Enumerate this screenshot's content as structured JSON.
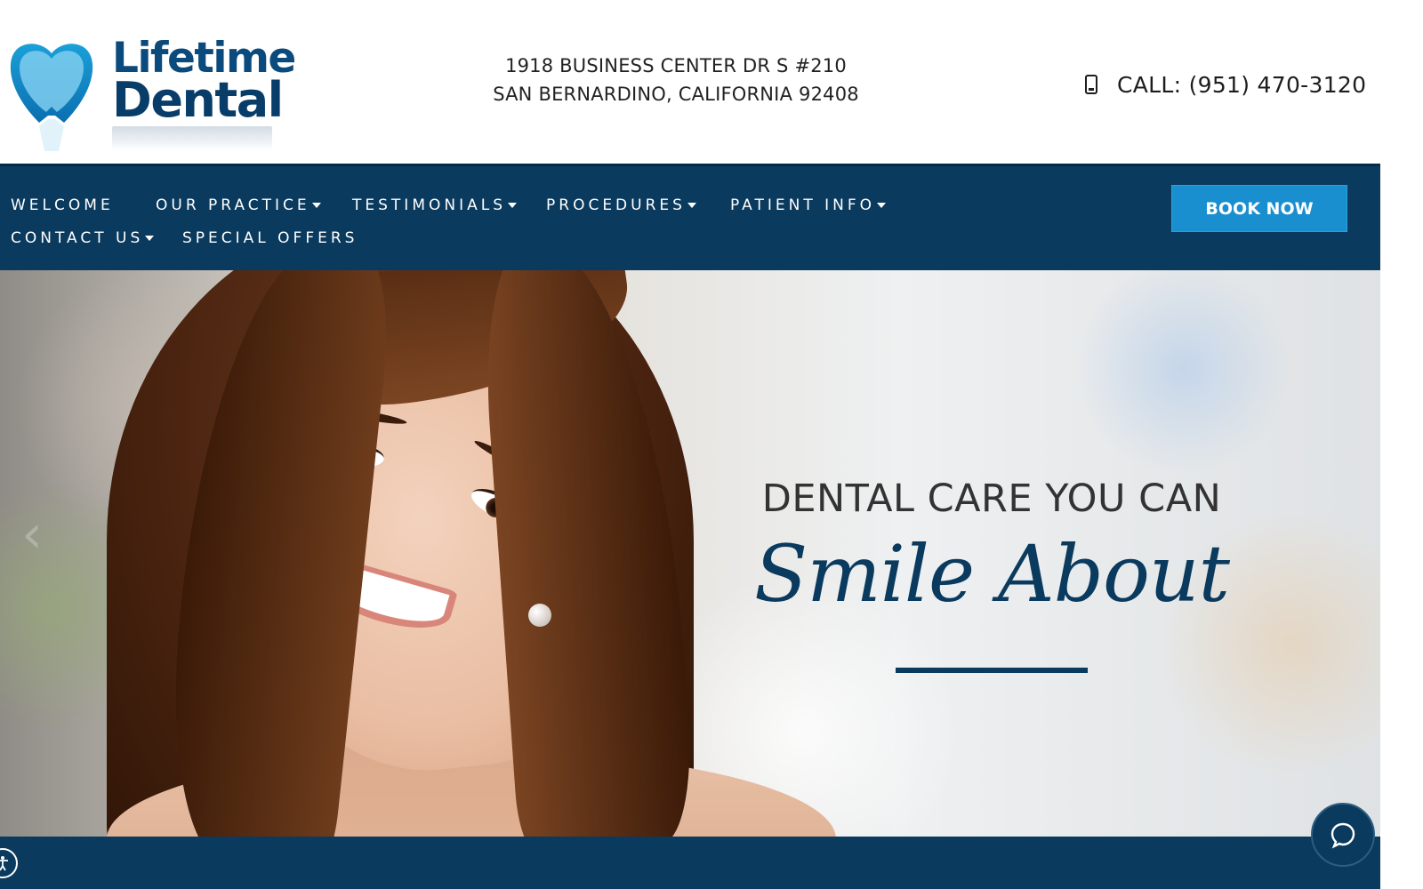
{
  "header": {
    "logo": {
      "line1": "Lifetime",
      "line2": "Dental"
    },
    "address": {
      "line1": "1918 BUSINESS CENTER DR S #210",
      "line2": "SAN BERNARDINO, CALIFORNIA 92408"
    },
    "phone": {
      "label": "CALL: (951) 470-3120",
      "icon": "mobile-phone-icon"
    }
  },
  "nav": {
    "items": [
      {
        "label": "WELCOME",
        "has_dropdown": false
      },
      {
        "label": "OUR PRACTICE",
        "has_dropdown": true
      },
      {
        "label": "TESTIMONIALS",
        "has_dropdown": true
      },
      {
        "label": "PROCEDURES",
        "has_dropdown": true
      },
      {
        "label": "PATIENT INFO",
        "has_dropdown": true
      },
      {
        "label": "CONTACT US",
        "has_dropdown": true
      },
      {
        "label": "SPECIAL OFFERS",
        "has_dropdown": false
      }
    ],
    "book_button": "BOOK NOW"
  },
  "hero": {
    "tagline": "DENTAL CARE YOU CAN",
    "script": "Smile About",
    "prev_arrow": "‹"
  },
  "colors": {
    "brand_navy": "#0a3a5e",
    "accent_blue": "#1a8fcf",
    "text_dark": "#1d1d1d"
  },
  "widgets": {
    "accessibility_icon": "accessibility-icon",
    "chat_icon": "chat-icon"
  }
}
